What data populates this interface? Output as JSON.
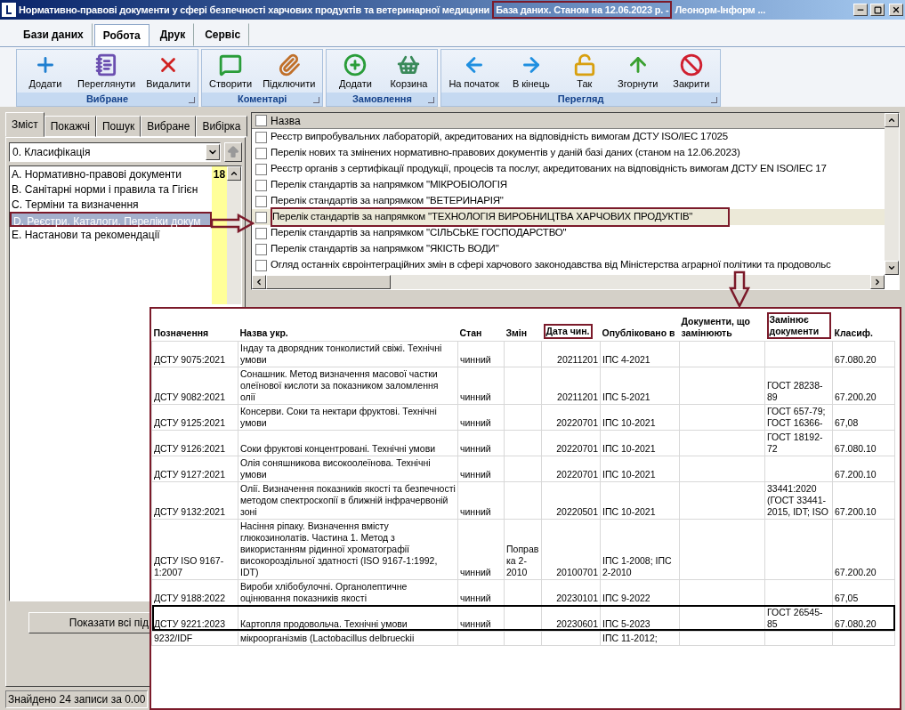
{
  "window": {
    "title": "Нормативно-правові документи у сфері безпечності харчових продуктів та ветеринарної медицини",
    "title_highlight": "База даних. Станом на 12.06.2023 р. -",
    "title_tail": "Леонорм-Інформ ..."
  },
  "ribbon_tabs": [
    {
      "label": "Бази даних",
      "selected": false
    },
    {
      "label": "Робота",
      "selected": true
    },
    {
      "label": "Друк",
      "selected": false
    },
    {
      "label": "Сервіс",
      "selected": false
    }
  ],
  "ribbon_groups": [
    {
      "label": "Вибране",
      "buttons": [
        "Додати",
        "Переглянути",
        "Видалити"
      ]
    },
    {
      "label": "Коментарі",
      "buttons": [
        "Створити",
        "Підключити"
      ]
    },
    {
      "label": "Замовлення",
      "buttons": [
        "Додати",
        "Корзина"
      ]
    },
    {
      "label": "Перегляд",
      "buttons": [
        "На початок",
        "В кінець",
        "Так",
        "Згорнути",
        "Закрити"
      ]
    }
  ],
  "sidebar": {
    "tabs": [
      {
        "label": "Зміст",
        "selected": true
      },
      {
        "label": "Покажчі",
        "selected": false
      },
      {
        "label": "Пошук",
        "selected": false
      },
      {
        "label": "Вибране",
        "selected": false
      },
      {
        "label": "Вибірка",
        "selected": false
      }
    ],
    "dropdown": "0. Класифікація",
    "count": "18",
    "items": [
      {
        "label": "A. Нормативно-правові документи",
        "selected": false
      },
      {
        "label": "B. Санітарні норми і правила та Гігієн",
        "selected": false
      },
      {
        "label": "C. Терміни та визначення",
        "selected": false
      },
      {
        "label": "D. Реєстри. Каталоги. Переліки докум",
        "selected": true
      },
      {
        "label": "E. Настанови та рекомендації",
        "selected": false
      }
    ],
    "show_all_button": "Показати всі під",
    "status": "Знайдено 24 записи за 0.00"
  },
  "doc_list": {
    "header": "Назва",
    "header_checked": false,
    "items": [
      {
        "label": "Реєстр випробувальних лабораторій, акредитованих на відповідність вимогам ДСТУ ISO/IEC 17025",
        "checked": false,
        "selected": false
      },
      {
        "label": "Перелік нових та змінених нормативно-правових документів у даній базі даних (станом на 12.06.2023)",
        "checked": false,
        "selected": false
      },
      {
        "label": "Реєстр органів з сертифікації продукції, процесів та послуг, акредитованих на відповідність вимогам ДСТУ EN ISO/IEC 17",
        "checked": false,
        "selected": false
      },
      {
        "label": "Перелік стандартів за напрямком \"МІКРОБІОЛОГІЯ",
        "checked": false,
        "selected": false
      },
      {
        "label": "Перелік стандартів за напрямком \"ВЕТЕРИНАРІЯ\"",
        "checked": false,
        "selected": false
      },
      {
        "label": "Перелік стандартів за напрямком \"ТЕХНОЛОГІЯ ВИРОБНИЦТВА ХАРЧОВИХ ПРОДУКТІВ\"",
        "checked": false,
        "selected": true
      },
      {
        "label": "Перелік стандартів за напрямком \"СІЛЬСЬКЕ ГОСПОДАРСТВО\"",
        "checked": false,
        "selected": false
      },
      {
        "label": "Перелік стандартів за напрямком \"ЯКІСТЬ ВОДИ\"",
        "checked": false,
        "selected": false
      },
      {
        "label": "Огляд останніх євроінтеграційних змін в сфері харчового законодавства від Міністерства аграрної політики та продовольс",
        "checked": false,
        "selected": false
      }
    ]
  },
  "table": {
    "columns": [
      {
        "label": "Позначення",
        "highlighted": false
      },
      {
        "label": "Назва укр.",
        "highlighted": false
      },
      {
        "label": "Стан",
        "highlighted": false
      },
      {
        "label": "Змін",
        "highlighted": false
      },
      {
        "label": "Дата чин.",
        "highlighted": true
      },
      {
        "label": "Опубліковано в",
        "highlighted": false
      },
      {
        "label": "Документи, що замінюють",
        "highlighted": false
      },
      {
        "label": "Замінює документи",
        "highlighted": true
      },
      {
        "label": "Класиф.",
        "highlighted": false
      }
    ],
    "rows": [
      {
        "highlighted": false,
        "cells": [
          "ДСТУ 9075:2021",
          "Індау та дворядник тонколистий свіжі. Технічні умови",
          "чинний",
          null,
          "20211201",
          "ІПС 4-2021",
          null,
          null,
          "67.080.20"
        ]
      },
      {
        "highlighted": false,
        "cells": [
          "ДСТУ 9082:2021",
          "Сонашник. Метод визначення масової частки олеїнової кислоти за показником заломлення олії",
          "чинний",
          null,
          "20211201",
          "ІПС 5-2021",
          null,
          "ГОСТ 28238-89",
          "67.200.20"
        ]
      },
      {
        "highlighted": false,
        "cells": [
          "ДСТУ 9125:2021",
          "Консерви. Соки та нектари фруктові. Технічні умови",
          "чинний",
          null,
          "20220701",
          "ІПС 10-2021",
          null,
          "ГОСТ 657-79; ГОСТ 16366-",
          "67,08"
        ]
      },
      {
        "highlighted": false,
        "cells": [
          "ДСТУ 9126:2021",
          "Соки фруктові концентровані. Технічні умови",
          "чинний",
          null,
          "20220701",
          "ІПС 10-2021",
          null,
          "ГОСТ 18192-72",
          "67.080.10"
        ]
      },
      {
        "highlighted": false,
        "cells": [
          "ДСТУ 9127:2021",
          "Олія соняшникова високоолеїнова. Технічні умови",
          "чинний",
          null,
          "20220701",
          "ІПС 10-2021",
          null,
          null,
          "67.200.10"
        ]
      },
      {
        "highlighted": false,
        "cells": [
          "ДСТУ 9132:2021",
          "Олії. Визначення показників якості та безпечності методом спектроскопії в ближній інфрачервоній зоні",
          "чинний",
          null,
          "20220501",
          "ІПС 10-2021",
          null,
          "33441:2020 (ГОСТ 33441-2015, IDT; ISO",
          "67.200.10"
        ]
      },
      {
        "highlighted": false,
        "cells": [
          "ДСТУ ISO 9167-1:2007",
          "Насіння ріпаку. Визначення вмісту глюкозинолатів. Частина 1. Метод з використанням рідинної хроматографії високороздільної здатності (ISO 9167-1:1992, IDT)",
          "чинний",
          "Поправка 2-2010",
          "20100701",
          "ІПС 1-2008; ІПС 2-2010",
          null,
          null,
          "67.200.20"
        ]
      },
      {
        "highlighted": false,
        "cells": [
          "ДСТУ 9188:2022",
          "Вироби хлібобулочні. Органолептичне оцінювання показників якості",
          "чинний",
          null,
          "20230101",
          "ІПС 9-2022",
          null,
          null,
          "67,05"
        ]
      },
      {
        "highlighted": true,
        "cells": [
          "ДСТУ 9221:2023",
          "Картопля продовольча. Технічні умови",
          "чинний",
          null,
          "20230601",
          "ІПС 5-2023",
          null,
          "ГОСТ 26545-85",
          "67.080.20"
        ]
      },
      {
        "highlighted": false,
        "cells": [
          "9232/IDF",
          "мікроорганізмів (Lactobacillus delbrueckii",
          null,
          null,
          null,
          "ІПС 11-2012;",
          null,
          null,
          null
        ]
      }
    ]
  }
}
